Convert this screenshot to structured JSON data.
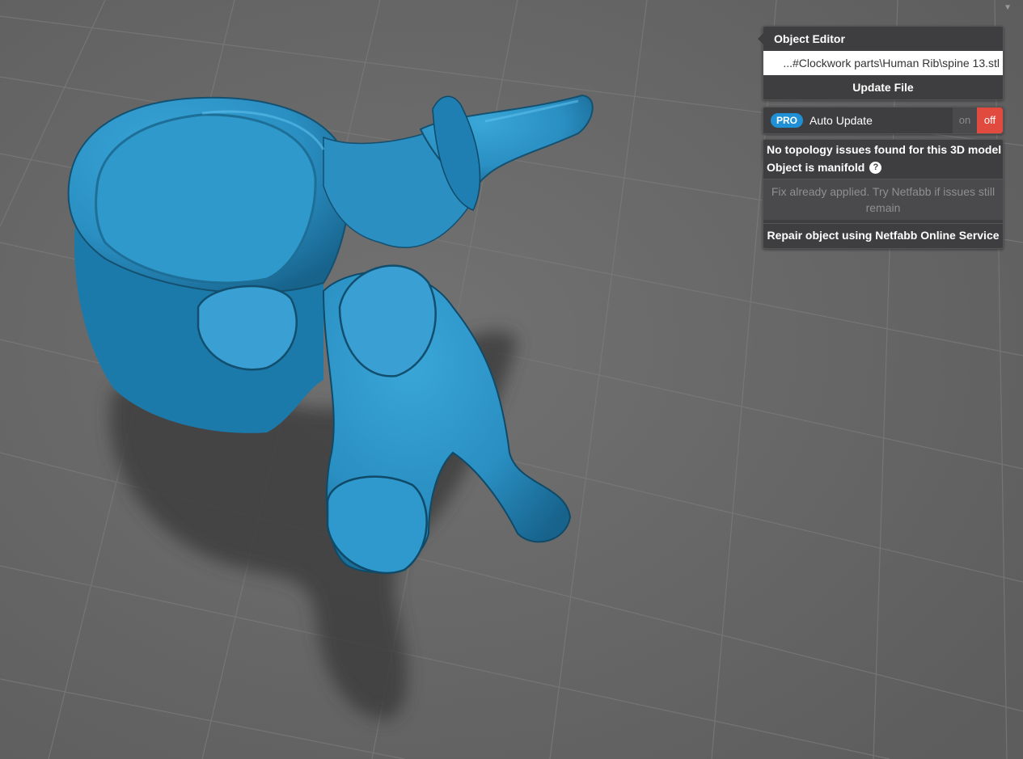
{
  "object_editor": {
    "title": "Object Editor",
    "file_path": "...#Clockwork parts\\Human Rib\\spine 13.stl",
    "update_file_label": "Update File"
  },
  "auto_update": {
    "pro_badge": "PRO",
    "label": "Auto Update",
    "on_label": "on",
    "off_label": "off",
    "state": "off"
  },
  "topology": {
    "status": "No topology issues found for this 3D model",
    "manifold": "Object is manifold",
    "help_icon": "?",
    "fix_applied": "Fix already applied. Try Netfabb if issues still remain",
    "repair_label": "Repair object using Netfabb Online Service"
  },
  "colors": {
    "model": "#2e97c9",
    "background": "#6a6a6a",
    "panel": "#3e3e40",
    "pro_badge": "#1f8fd6",
    "toggle_off": "#e04a3f"
  },
  "icons": {
    "help": "help-icon",
    "panel_caret": "caret-down-icon"
  }
}
